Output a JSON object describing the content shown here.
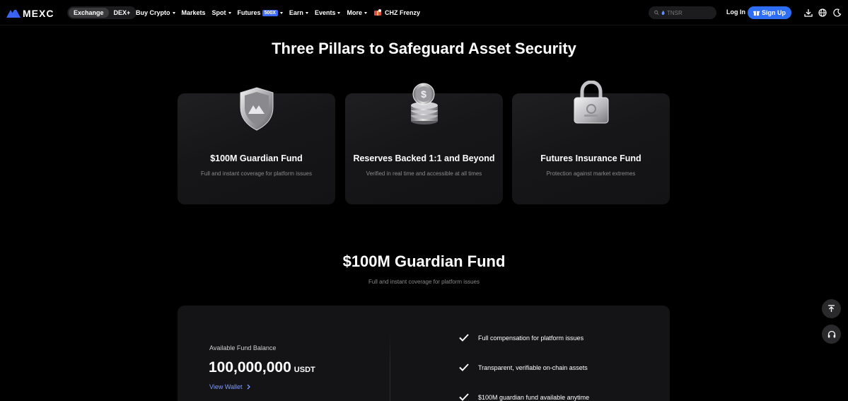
{
  "nav": {
    "logo_text": "MEXC",
    "segments": [
      {
        "label": "Exchange",
        "active": true
      },
      {
        "label": "DEX+",
        "active": false
      }
    ],
    "menu": [
      {
        "label": "Buy Crypto",
        "caret": true
      },
      {
        "label": "Markets",
        "caret": false
      },
      {
        "label": "Spot",
        "caret": true
      },
      {
        "label": "Futures",
        "caret": true,
        "badge": "500X"
      },
      {
        "label": "Earn",
        "caret": true
      },
      {
        "label": "Events",
        "caret": true
      },
      {
        "label": "More",
        "caret": true
      },
      {
        "label": "CHZ Frenzy",
        "caret": false,
        "icon": "gift-promo-icon"
      }
    ],
    "search_placeholder": "TNSR",
    "login_label": "Log In",
    "signup_label": "Sign Up",
    "right_icons": [
      "download-icon",
      "globe-icon",
      "moon-icon"
    ],
    "accent_color": "#2e6ef5"
  },
  "pillars": {
    "title": "Three Pillars to Safeguard Asset Security",
    "cards": [
      {
        "icon": "shield-icon",
        "title": "$100M Guardian Fund",
        "desc": "Full and instant coverage for platform issues"
      },
      {
        "icon": "coins-icon",
        "title": "Reserves Backed 1:1 and Beyond",
        "desc": "Verified in real time and accessible at all times"
      },
      {
        "icon": "padlock-icon",
        "title": "Futures Insurance Fund",
        "desc": "Protection against market extremes"
      }
    ]
  },
  "guardian": {
    "title": "$100M Guardian Fund",
    "subtitle": "Full and instant coverage for platform issues",
    "balance_label": "Available Fund Balance",
    "balance_value": "100,000,000",
    "balance_unit": "USDT",
    "view_wallet_label": "View Wallet",
    "features": [
      "Full compensation for platform issues",
      "Transparent, verifiable on-chain assets",
      "$100M guardian fund available anytime"
    ]
  },
  "floating": [
    "back-to-top-icon",
    "headset-support-icon"
  ]
}
